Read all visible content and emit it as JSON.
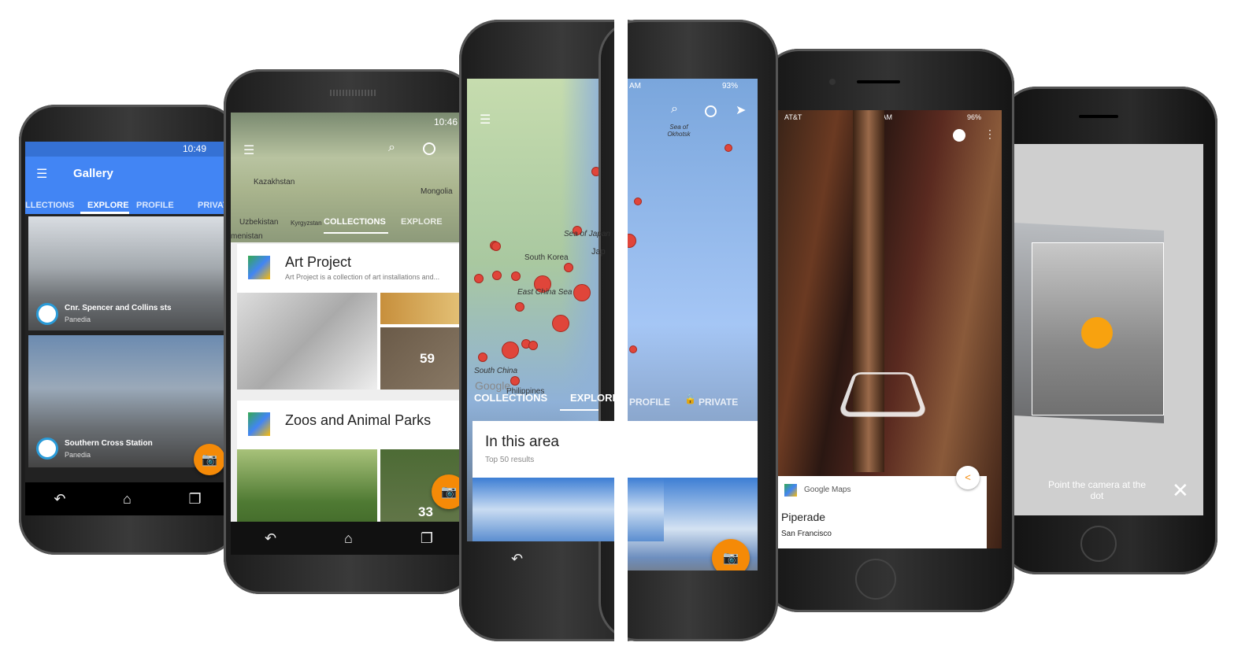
{
  "phone_gallery": {
    "status_time": "10:49",
    "title": "Gallery",
    "tabs": [
      "LLECTIONS",
      "EXPLORE",
      "PROFILE",
      "PRIVAT"
    ],
    "items": [
      {
        "title": "Cnr. Spencer and Collins sts",
        "subtitle": "Panedia"
      },
      {
        "title": "Southern Cross Station",
        "subtitle": "Panedia"
      }
    ]
  },
  "phone_collections": {
    "status_time": "10:46",
    "map_labels": [
      "Kazakhstan",
      "Mongolia",
      "Uzbekistan",
      "Kyrgyzstan",
      "menistan"
    ],
    "tabs": [
      "COLLECTIONS",
      "EXPLORE"
    ],
    "cards": [
      {
        "title": "Art Project",
        "description": "Art Project is a collection of art installations and...",
        "count": "59"
      },
      {
        "title": "Zoos and Animal Parks",
        "count": "33"
      }
    ]
  },
  "phone_explore": {
    "status_time": "AM",
    "battery": "93%",
    "map_labels": [
      "Sea of Japan",
      "South Korea",
      "Jap",
      "East China Sea",
      "South China",
      "Philippines",
      "Sea of Okhotsk",
      "Google"
    ],
    "tabs": [
      "COLLECTIONS",
      "EXPLORE",
      "PROFILE",
      "PRIVATE"
    ],
    "card": {
      "title": "In this area",
      "subtitle": "Top 50 results"
    }
  },
  "phone_viewer": {
    "carrier": "AT&T",
    "status_time": "9:30 AM",
    "battery": "96%",
    "card": {
      "source": "Google Maps",
      "title": "Piperade",
      "subtitle": "San Francisco"
    }
  },
  "phone_camera": {
    "instruction": "Point the camera at the dot"
  },
  "colors": {
    "accent": "#f58a07",
    "app_bar": "#4285f4",
    "map_dot": "#e0453a"
  }
}
